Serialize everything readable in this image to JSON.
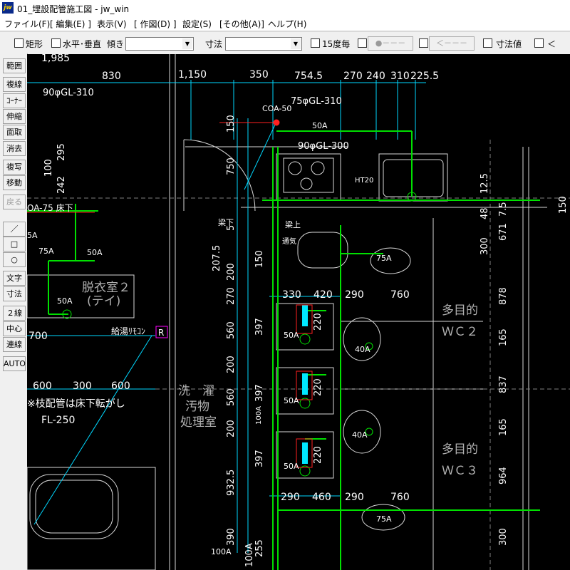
{
  "window": {
    "title": "01_埋設配管施工図 - jw_win",
    "icon_text": "jw"
  },
  "menu": [
    "ファイル(F)",
    "[ 編集(E) ]",
    "表示(V)",
    "[ 作図(D) ]",
    "設定(S)",
    "[その他(A)]",
    "ヘルプ(H)"
  ],
  "toolbar": {
    "rect_label": "矩形",
    "hv_label": "水平･垂直",
    "tilt_label": "傾き",
    "dim_label": "寸法",
    "deg15_label": "15度毎",
    "btn_dot": "●－－－",
    "btn_arrow": "＜－－－",
    "dimval_label": "寸法値",
    "lt_label": "＜"
  },
  "left_tools": [
    {
      "label": "範囲",
      "enabled": true
    },
    {
      "label": "複線",
      "enabled": true
    },
    {
      "label": "ｺｰﾅｰ",
      "enabled": true
    },
    {
      "label": "伸縮",
      "enabled": true
    },
    {
      "label": "面取",
      "enabled": true
    },
    {
      "label": "消去",
      "enabled": true
    },
    {
      "label": "複写",
      "enabled": true
    },
    {
      "label": "移動",
      "enabled": true
    },
    {
      "label": "戻る",
      "enabled": false
    },
    {
      "label": "／",
      "enabled": true
    },
    {
      "label": "□",
      "enabled": true
    },
    {
      "label": "○",
      "enabled": true
    },
    {
      "label": "文字",
      "enabled": true
    },
    {
      "label": "寸法",
      "enabled": true
    },
    {
      "label": "２線",
      "enabled": true
    },
    {
      "label": "中心線",
      "enabled": true
    },
    {
      "label": "連線",
      "enabled": true
    },
    {
      "label": "AUTO",
      "enabled": true
    }
  ],
  "drawing": {
    "dims_top": [
      "1,985",
      "830",
      "1,150",
      "350",
      "754.5",
      "270",
      "240",
      "310",
      "225.5"
    ],
    "pipe_labels": [
      "90φGL-310",
      "75φGL-310",
      "COA-50",
      "50A",
      "90φGL-300",
      "HT20",
      "OA-75 床下",
      "75A",
      "50A",
      "5A",
      "通気",
      "梁上",
      "梁下",
      "50A",
      "75A",
      "50A",
      "40A",
      "50A",
      "40A",
      "50A",
      "75A",
      "100A",
      "100A"
    ],
    "room_labels": [
      "脱衣室２",
      "(テイ)",
      "洗　濯",
      "汚物",
      "処理室",
      "多目的",
      "ＷＣ２",
      "多目的",
      "ＷＣ３"
    ],
    "remote_label": "給湯ﾘﾓｺﾝ",
    "remote_mark": "R",
    "note": "※枝配管は床下転がし",
    "note2": "FL-250",
    "dims_mid": [
      "330",
      "420",
      "290",
      "760",
      "290",
      "460",
      "290",
      "760",
      "600",
      "300",
      "600",
      "700"
    ],
    "dims_vert_left": [
      "150",
      "750",
      "5",
      "207.5",
      "200",
      "270",
      "560",
      "200",
      "560",
      "200",
      "932.5",
      "390",
      "150",
      "397",
      "397",
      "397",
      "255",
      "100A",
      "220",
      "220",
      "220",
      "100",
      "242",
      "295"
    ],
    "dims_vert_right": [
      "12.5",
      "48",
      "7.5",
      "671",
      "300",
      "878",
      "165",
      "837",
      "165",
      "964",
      "300",
      "150"
    ]
  },
  "colors": {
    "canvas": "#000000",
    "pipe": "#00ff00",
    "dim": "#00ffff",
    "wall": "#ffffff",
    "accent_red": "#ff2020",
    "remote_box": "#ff00ff"
  }
}
